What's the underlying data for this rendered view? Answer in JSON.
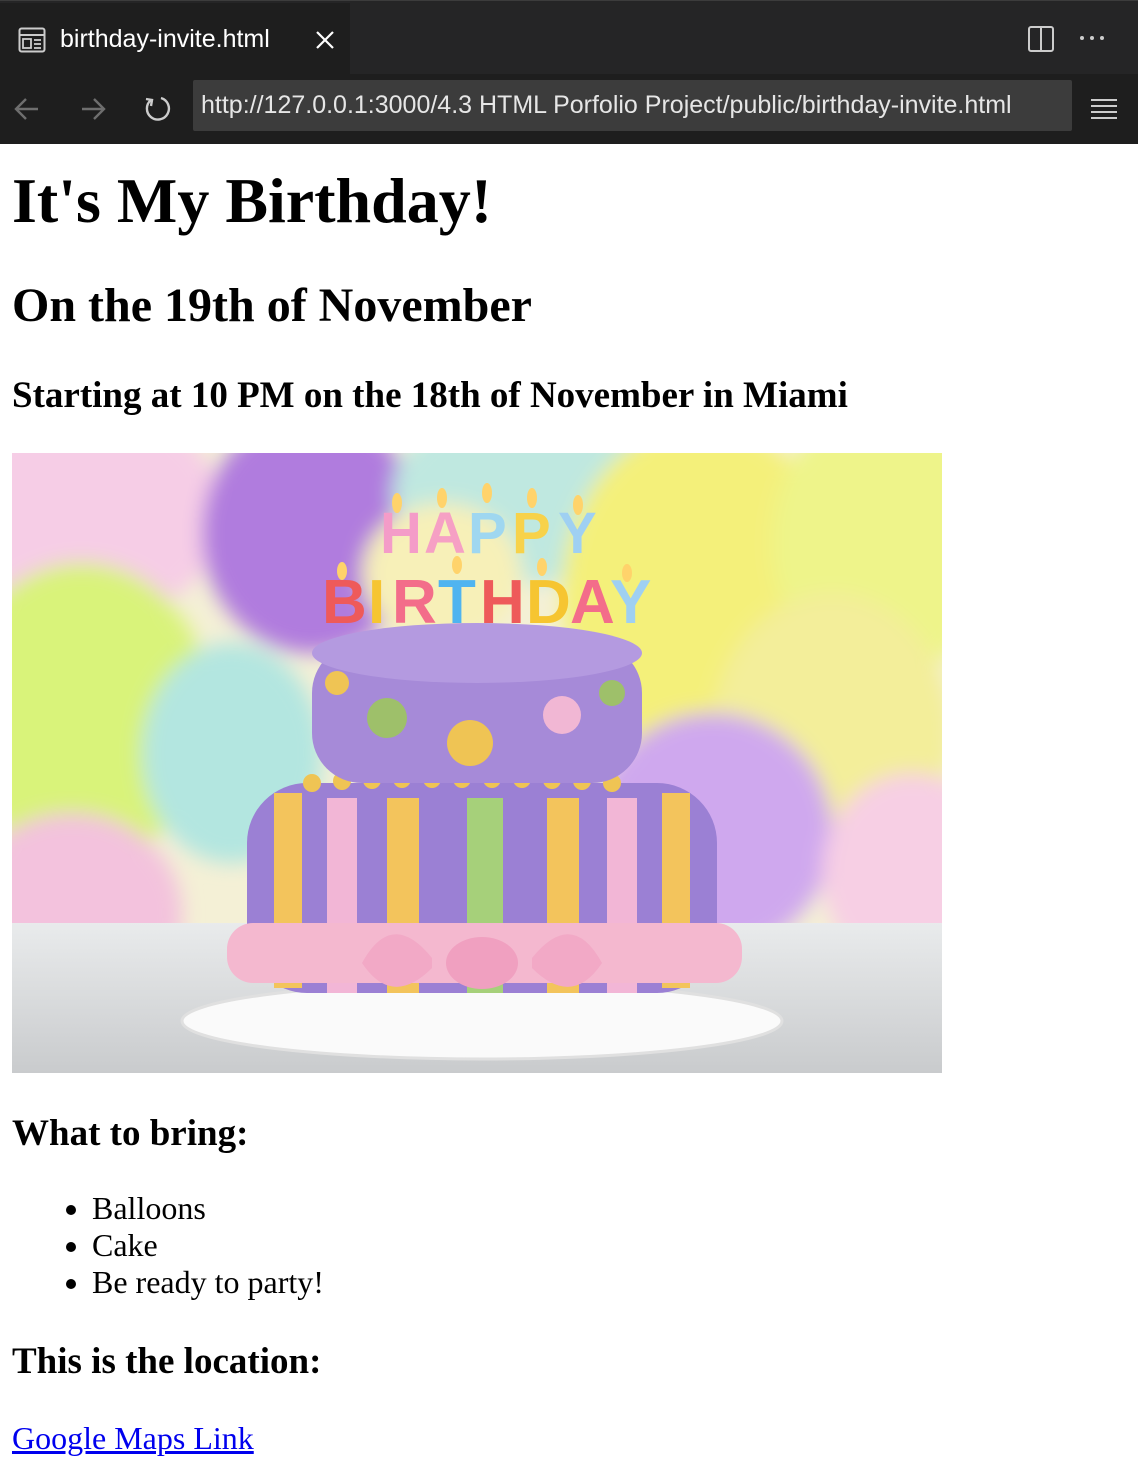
{
  "browser": {
    "tab_title": "birthday-invite.html",
    "url": "http://127.0.0.1:3000/4.3 HTML Porfolio Project/public/birthday-invite.html",
    "icons": {
      "page": "page-icon",
      "close": "close-icon",
      "split": "split-editor-icon",
      "more": "more-icon",
      "back": "back-arrow-icon",
      "forward": "forward-arrow-icon",
      "reload": "reload-icon",
      "menu": "menu-icon"
    },
    "colors": {
      "chrome": "#1e1e1e",
      "tabbar": "#252526",
      "url_bar": "#3c3c3c"
    }
  },
  "page": {
    "title": "It's My Birthday!",
    "date": "On the 19th of November",
    "start": "Starting at 10 PM on the 18th of November in Miami",
    "image_text": {
      "line1": "HAPPY",
      "line2": "BIRTHDAY"
    },
    "bring_heading": "What to bring:",
    "bring_items": [
      "Balloons",
      "Cake",
      "Be ready to party!"
    ],
    "location_heading": "This is the location:",
    "maps_link": "Google Maps Link",
    "link_color": "#0000ee"
  }
}
